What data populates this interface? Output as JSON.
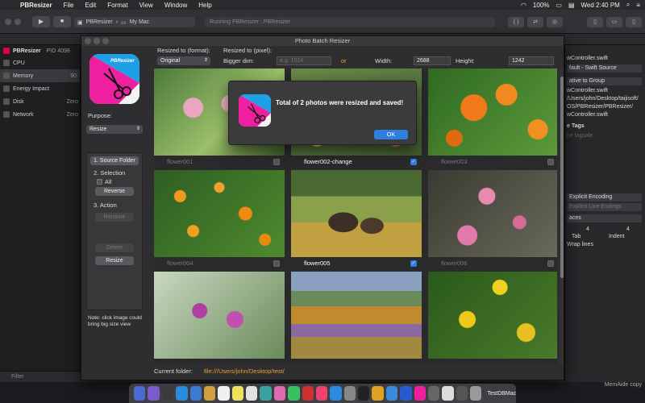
{
  "menubar": {
    "items": [
      "PBResizer",
      "File",
      "Edit",
      "Format",
      "View",
      "Window",
      "Help"
    ],
    "battery": "100%",
    "clock": "Wed 2:40 PM"
  },
  "xcode": {
    "scheme": "PBResizer",
    "destination": "My Mac",
    "activity": "Running PBResizer : PBResizer"
  },
  "debug_nav": {
    "process": "PBResizer",
    "pid": "PID 4098",
    "gauges": [
      {
        "label": "CPU",
        "value": ""
      },
      {
        "label": "Memory",
        "value": "90."
      },
      {
        "label": "Energy Impact",
        "value": ""
      },
      {
        "label": "Disk",
        "value": "Zero"
      },
      {
        "label": "Network",
        "value": "Zero"
      }
    ],
    "filter_placeholder": "Filter"
  },
  "inspector": {
    "rows": [
      "wController.swift",
      "fault - Swift Source",
      "ative to Group",
      "wController.swift",
      "/Users/john/Desktop/taijisoft/",
      "OS/PBResizer/PBResizer/",
      "wController.swift",
      "e Tags",
      "ne tagsale",
      "Explicit Encoding",
      "Explicit Line Endings",
      "aces",
      "4",
      "Tab",
      "4",
      "Indent",
      "Wrap lines"
    ],
    "memaide": "MemAide copy"
  },
  "pbwindow": {
    "title": "Photo Batch Resizer",
    "app_icon_text": "PBResizer",
    "purpose_label": "Purpose:",
    "purpose_value": "Resize",
    "source_folder_button": "1. Source Folder",
    "selection_label": "2. Selection",
    "all_label": "All",
    "reverse_button": "Reverse",
    "action_label": "3. Action",
    "rename_button": "Rename",
    "delete_button": "Delete",
    "resize_button": "Resize",
    "note": "Note: click image could bring big size view",
    "resized_to_format_label": "Resized to (format):",
    "format_value": "Original",
    "resized_to_pixel_label": "Resized to (pixel):",
    "bigger_dim_label": "Bigger dim:",
    "bigger_dim_placeholder": "e.g. 1024",
    "or_label": "or",
    "width_label": "Width:",
    "width_value": "2688",
    "height_label": "Height:",
    "height_value": "1242",
    "current_folder_label": "Current folder:",
    "current_folder_value": "file:///Users/john/Desktop/test/",
    "photos": [
      {
        "name": "flower001",
        "checked": false,
        "highlight": false
      },
      {
        "name": "flower002-change",
        "checked": true,
        "highlight": true
      },
      {
        "name": "flower003",
        "checked": false,
        "highlight": false
      },
      {
        "name": "flower004",
        "checked": false,
        "highlight": false
      },
      {
        "name": "flower005",
        "checked": true,
        "highlight": true
      },
      {
        "name": "flower006",
        "checked": false,
        "highlight": false
      },
      {
        "name": "",
        "checked": false,
        "highlight": false
      },
      {
        "name": "",
        "checked": false,
        "highlight": false
      },
      {
        "name": "",
        "checked": false,
        "highlight": false
      }
    ]
  },
  "alert": {
    "message": "Total of 2 photos were resized and saved!",
    "ok_button": "OK"
  },
  "dock": {
    "label": "TestDBMac"
  }
}
